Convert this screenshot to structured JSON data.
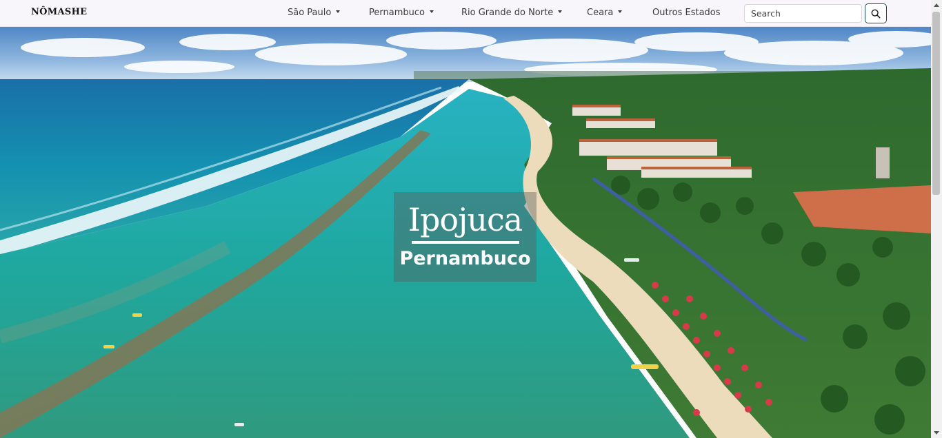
{
  "navbar": {
    "brand": "NÔMASHE",
    "items": [
      {
        "label": "São Paulo",
        "dropdown": true
      },
      {
        "label": "Pernambuco",
        "dropdown": true
      },
      {
        "label": "Rio Grande do Norte",
        "dropdown": true
      },
      {
        "label": "Ceara",
        "dropdown": true
      },
      {
        "label": "Outros Estados",
        "dropdown": false
      }
    ],
    "search": {
      "placeholder": "Search",
      "value": "",
      "button_icon": "search-icon"
    }
  },
  "hero": {
    "title": "Ipojuca",
    "subtitle": "Pernambuco"
  },
  "colors": {
    "accent": "#1c4e4e",
    "navbar_bg": "#f8f6fa"
  }
}
